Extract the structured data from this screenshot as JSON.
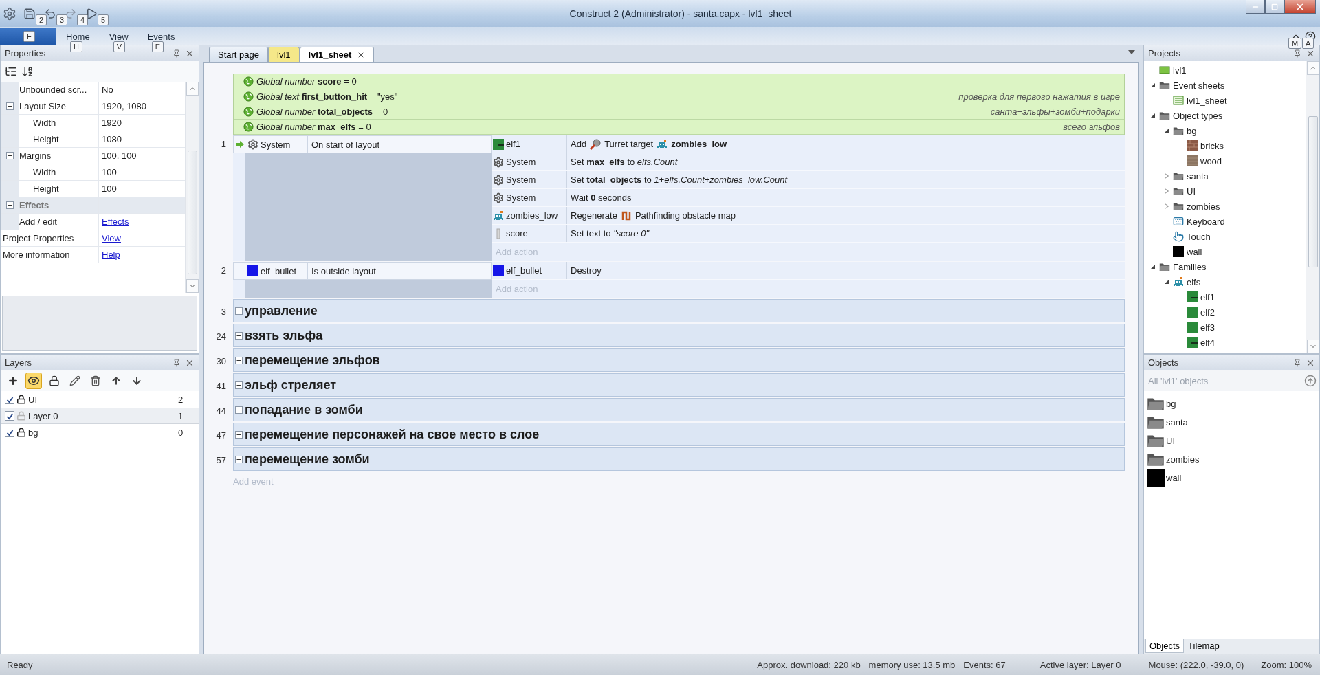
{
  "window": {
    "title": "Construct 2 (Administrator) - santa.capx - lvl1_sheet"
  },
  "quick_access": [
    {
      "kind": "save",
      "tip": "2"
    },
    {
      "kind": "undo",
      "tip": "3"
    },
    {
      "kind": "redo",
      "tip": "4"
    },
    {
      "kind": "preview",
      "tip": "5"
    }
  ],
  "ribbon": {
    "file_tip": "F",
    "tabs": [
      {
        "label": "Home",
        "tip": "H"
      },
      {
        "label": "View",
        "tip": "V"
      },
      {
        "label": "Events",
        "tip": "E"
      }
    ],
    "right_tips": [
      "M",
      "A"
    ]
  },
  "properties": {
    "title": "Properties",
    "rows": [
      {
        "kind": "plain",
        "name": "Unbounded scr...",
        "value": "No"
      },
      {
        "kind": "expandable",
        "name": "Layout Size",
        "value": "1920, 1080",
        "expanded": true
      },
      {
        "kind": "child",
        "name": "Width",
        "value": "1920"
      },
      {
        "kind": "child",
        "name": "Height",
        "value": "1080"
      },
      {
        "kind": "expandable",
        "name": "Margins",
        "value": "100, 100",
        "expanded": true
      },
      {
        "kind": "child",
        "name": "Width",
        "value": "100"
      },
      {
        "kind": "child",
        "name": "Height",
        "value": "100"
      },
      {
        "kind": "category",
        "name": "Effects",
        "expanded": true
      },
      {
        "kind": "link",
        "name": "Add / edit",
        "value": "Effects"
      },
      {
        "kind": "root-link",
        "name": "Project Properties",
        "value": "View"
      },
      {
        "kind": "root-link",
        "name": "More information",
        "value": "Help"
      }
    ]
  },
  "layers": {
    "title": "Layers",
    "tools": [
      {
        "kind": "add",
        "on": false
      },
      {
        "kind": "eye",
        "on": true
      },
      {
        "kind": "lock",
        "on": false
      },
      {
        "kind": "edit",
        "on": false
      },
      {
        "kind": "delete",
        "on": false
      },
      {
        "kind": "up",
        "on": false
      },
      {
        "kind": "down",
        "on": false
      }
    ],
    "rows": [
      {
        "name": "UI",
        "count": "2",
        "checked": true,
        "locked": true,
        "selected": false
      },
      {
        "name": "Layer 0",
        "count": "1",
        "checked": true,
        "locked": false,
        "selected": true
      },
      {
        "name": "bg",
        "count": "0",
        "checked": true,
        "locked": true,
        "selected": false
      }
    ]
  },
  "tabs": [
    {
      "label": "Start page",
      "kind": "start",
      "selected": false
    },
    {
      "label": "lvl1",
      "kind": "layout",
      "selected": false
    },
    {
      "label": "lvl1_sheet",
      "kind": "sheet",
      "selected": true
    }
  ],
  "event_sheet": {
    "globals": [
      {
        "type": "Global number",
        "name": "score",
        "value": "= 0"
      },
      {
        "type": "Global text",
        "name": "first_button_hit",
        "value": "= \"yes\"",
        "comment": "проверка для первого нажатия в игре"
      },
      {
        "type": "Global number",
        "name": "total_objects",
        "value": "= 0",
        "comment": "санта+эльфы+зомби+подарки"
      },
      {
        "type": "Global number",
        "name": "max_elfs",
        "value": "= 0",
        "comment": "всего эльфов"
      }
    ],
    "events": [
      {
        "number": "1",
        "conditions": [
          {
            "object": "System",
            "kind": "gear",
            "text": "On start of layout",
            "trigger": true
          }
        ],
        "actions": [
          {
            "object": "elf1",
            "kind": "sprite-mark",
            "segments": [
              {
                "kind": "text",
                "text": "Add"
              },
              {
                "kind": "turret"
              },
              {
                "kind": "text",
                "text": "Turret target"
              },
              {
                "kind": "zombie"
              },
              {
                "kind": "text",
                "text": "**zombies_low**"
              }
            ]
          },
          {
            "object": "System",
            "kind": "gear",
            "segments": [
              {
                "kind": "text",
                "text": "Set **max_elfs** to *elfs.Count*"
              }
            ]
          },
          {
            "object": "System",
            "kind": "gear",
            "segments": [
              {
                "kind": "text",
                "text": "Set **total_objects** to *1+elfs.Count+zombies_low.Count*"
              }
            ]
          },
          {
            "object": "System",
            "kind": "gear",
            "segments": [
              {
                "kind": "text",
                "text": "Wait **0** seconds"
              }
            ]
          },
          {
            "object": "zombies_low",
            "kind": "zombie",
            "segments": [
              {
                "kind": "text",
                "text": "Regenerate"
              },
              {
                "kind": "pathfinding"
              },
              {
                "kind": "text",
                "text": "Pathfinding obstacle map"
              }
            ]
          },
          {
            "object": "score",
            "kind": "text-object",
            "segments": [
              {
                "kind": "text",
                "text": "Set text to *\"score 0\"*"
              }
            ]
          }
        ],
        "add_action": "Add action"
      },
      {
        "number": "2",
        "conditions": [
          {
            "object": "elf_bullet",
            "kind": "blue",
            "text": "Is outside layout",
            "trigger": false
          }
        ],
        "actions": [
          {
            "object": "elf_bullet",
            "kind": "blue",
            "segments": [
              {
                "kind": "text",
                "text": "Destroy"
              }
            ]
          }
        ],
        "add_action": "Add action"
      }
    ],
    "groups": [
      {
        "number": "3",
        "title": "управление",
        "expanded": false
      },
      {
        "number": "24",
        "title": "взять эльфа",
        "expanded": false
      },
      {
        "number": "30",
        "title": "перемещение эльфов",
        "expanded": false
      },
      {
        "number": "41",
        "title": "эльф стреляет",
        "expanded": false
      },
      {
        "number": "44",
        "title": "попадание в зомби",
        "expanded": false
      },
      {
        "number": "47",
        "title": "перемещение персонажей на свое место в слое",
        "expanded": false
      },
      {
        "number": "57",
        "title": "перемещение зомби",
        "expanded": false
      }
    ],
    "add_event": "Add event"
  },
  "projects": {
    "title": "Projects",
    "tree": [
      {
        "label": "lvl1",
        "kind": "layout"
      },
      {
        "label": "Event sheets",
        "kind": "folder",
        "expanded": true,
        "children": [
          {
            "label": "lvl1_sheet",
            "kind": "sheet"
          }
        ]
      },
      {
        "label": "Object types",
        "kind": "folder",
        "expanded": true,
        "children": [
          {
            "label": "bg",
            "kind": "folder",
            "expanded": true,
            "children": [
              {
                "label": "bricks",
                "kind": "bricks"
              },
              {
                "label": "wood",
                "kind": "wood"
              }
            ]
          },
          {
            "label": "santa",
            "kind": "folder",
            "expanded": false
          },
          {
            "label": "UI",
            "kind": "folder",
            "expanded": false
          },
          {
            "label": "zombies",
            "kind": "folder",
            "expanded": false
          },
          {
            "label": "Keyboard",
            "kind": "keyboard"
          },
          {
            "label": "Touch",
            "kind": "touch"
          },
          {
            "label": "wall",
            "kind": "black"
          }
        ]
      },
      {
        "label": "Families",
        "kind": "folder",
        "expanded": true,
        "children": [
          {
            "label": "elfs",
            "kind": "zombie",
            "expanded": true,
            "children": [
              {
                "label": "elf1",
                "kind": "sprite-mark"
              },
              {
                "label": "elf2",
                "kind": "sprite"
              },
              {
                "label": "elf3",
                "kind": "sprite"
              },
              {
                "label": "elf4",
                "kind": "sprite-mark"
              }
            ]
          }
        ]
      }
    ]
  },
  "objects": {
    "title": "Objects",
    "filter_placeholder": "All 'lvl1' objects",
    "items": [
      {
        "name": "bg",
        "kind": "folder"
      },
      {
        "name": "santa",
        "kind": "folder"
      },
      {
        "name": "UI",
        "kind": "folder"
      },
      {
        "name": "zombies",
        "kind": "folder"
      },
      {
        "name": "wall",
        "kind": "black"
      }
    ],
    "tabs": [
      {
        "label": "Objects",
        "selected": true
      },
      {
        "label": "Tilemap",
        "selected": false
      }
    ]
  },
  "status_bar": {
    "left": "Ready",
    "fields": [
      "Approx. download: 220 kb",
      "memory use: 13.5 mb",
      "Events: 67",
      "Active layer: Layer 0",
      "Mouse: (222.0, -39.0, 0)",
      "Zoom: 100%"
    ]
  }
}
